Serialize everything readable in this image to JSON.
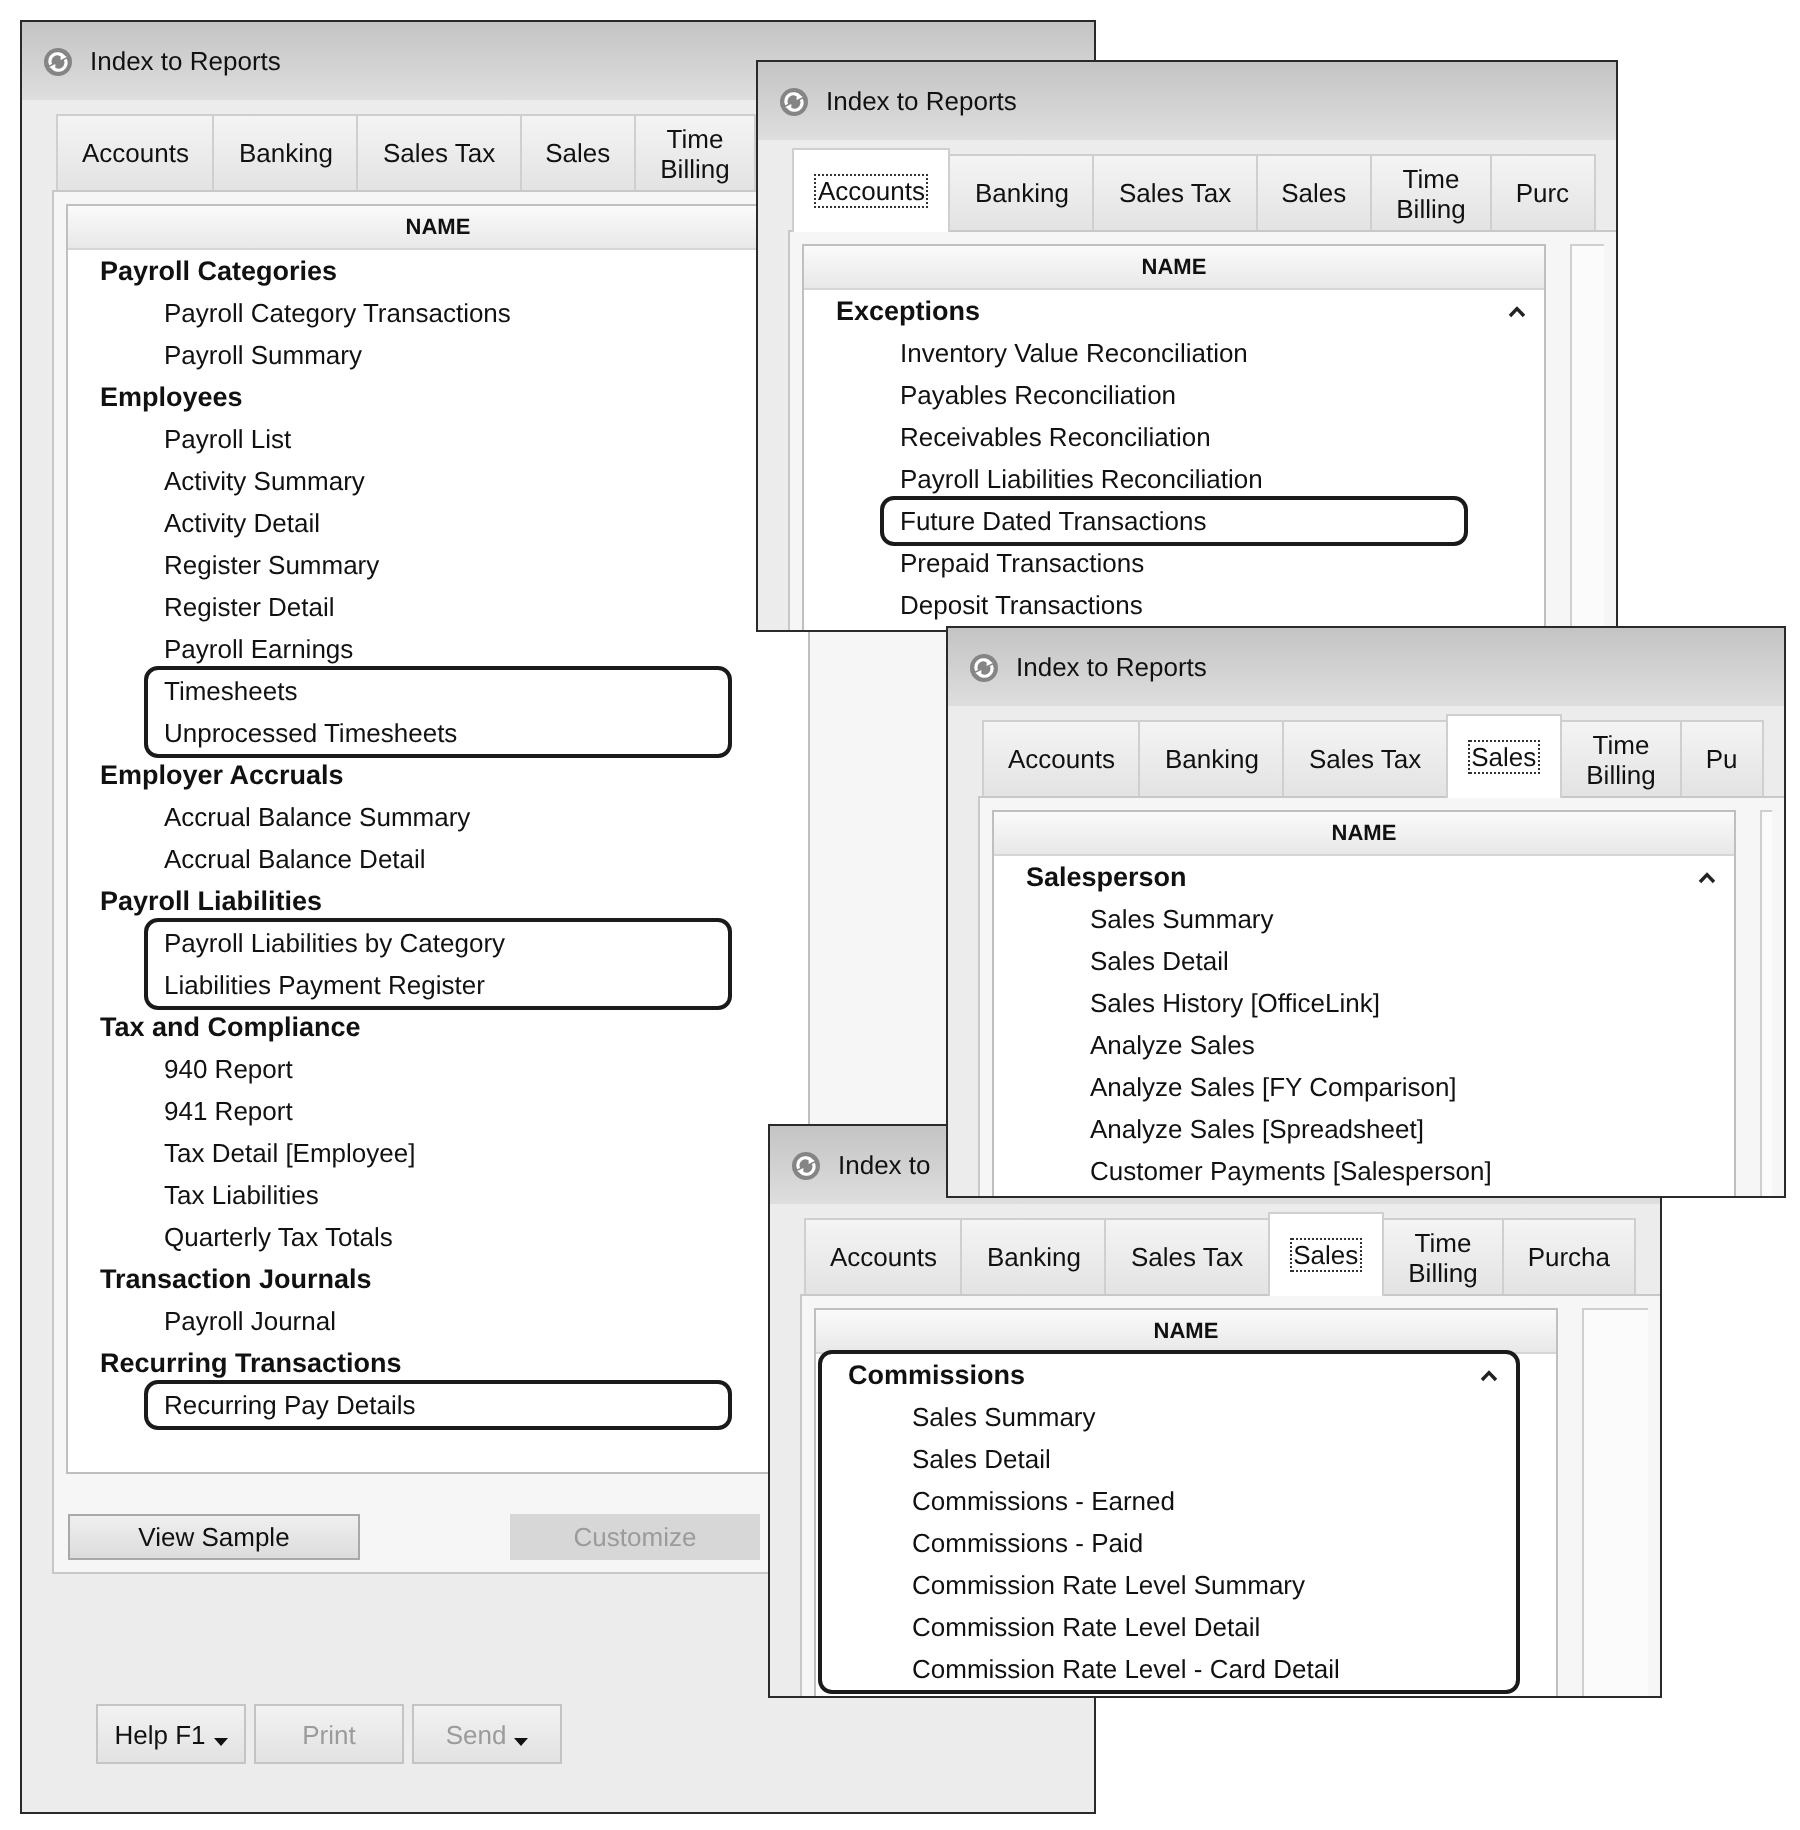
{
  "windows": [
    {
      "title": "Index to Reports",
      "tabs": [
        {
          "label": "Accounts",
          "selected": false
        },
        {
          "label": "Banking",
          "selected": false
        },
        {
          "label": "Sales Tax",
          "selected": false
        },
        {
          "label": "Sales",
          "selected": false
        },
        {
          "label": "Time\nBilling",
          "selected": false
        }
      ],
      "list": {
        "header": "NAME",
        "rows": [
          {
            "kind": "group",
            "text": "Payroll Categories"
          },
          {
            "kind": "item",
            "text": "Payroll Category Transactions"
          },
          {
            "kind": "item",
            "text": "Payroll Summary"
          },
          {
            "kind": "group",
            "text": "Employees"
          },
          {
            "kind": "item",
            "text": "Payroll List"
          },
          {
            "kind": "item",
            "text": "Activity Summary"
          },
          {
            "kind": "item",
            "text": "Activity Detail"
          },
          {
            "kind": "item",
            "text": "Register Summary"
          },
          {
            "kind": "item",
            "text": "Register Detail"
          },
          {
            "kind": "item",
            "text": "Payroll Earnings"
          },
          {
            "kind": "callout",
            "rows": [
              {
                "kind": "item",
                "text": "Timesheets"
              },
              {
                "kind": "item",
                "text": "Unprocessed Timesheets"
              }
            ]
          },
          {
            "kind": "group",
            "text": "Employer Accruals"
          },
          {
            "kind": "item",
            "text": "Accrual Balance Summary"
          },
          {
            "kind": "item",
            "text": "Accrual Balance Detail"
          },
          {
            "kind": "group",
            "text": "Payroll Liabilities"
          },
          {
            "kind": "callout",
            "rows": [
              {
                "kind": "item",
                "text": "Payroll Liabilities by Category"
              },
              {
                "kind": "item",
                "text": "Liabilities Payment Register"
              }
            ]
          },
          {
            "kind": "group",
            "text": "Tax and Compliance"
          },
          {
            "kind": "item",
            "text": "940 Report"
          },
          {
            "kind": "item",
            "text": "941 Report"
          },
          {
            "kind": "item",
            "text": "Tax Detail [Employee]"
          },
          {
            "kind": "item",
            "text": "Tax Liabilities"
          },
          {
            "kind": "item",
            "text": "Quarterly Tax Totals"
          },
          {
            "kind": "group",
            "text": "Transaction Journals"
          },
          {
            "kind": "item",
            "text": "Payroll Journal"
          },
          {
            "kind": "group",
            "text": "Recurring Transactions"
          },
          {
            "kind": "callout",
            "rows": [
              {
                "kind": "item",
                "text": "Recurring Pay Details"
              }
            ]
          }
        ]
      },
      "actions": [
        {
          "label": "View Sample",
          "disabled": false
        },
        {
          "label": "Customize",
          "disabled": true
        }
      ],
      "footer_buttons": [
        {
          "label": "Help F1",
          "disabled": false,
          "dropdown": true
        },
        {
          "label": "Print",
          "disabled": true,
          "dropdown": false
        },
        {
          "label": "Send",
          "disabled": true,
          "dropdown": true
        }
      ]
    },
    {
      "title": "Index to Reports",
      "tabs": [
        {
          "label": "Accounts",
          "selected": true
        },
        {
          "label": "Banking",
          "selected": false
        },
        {
          "label": "Sales Tax",
          "selected": false
        },
        {
          "label": "Sales",
          "selected": false
        },
        {
          "label": "Time\nBilling",
          "selected": false
        },
        {
          "label": "Purc",
          "selected": false
        }
      ],
      "list": {
        "header": "NAME",
        "rows": [
          {
            "kind": "group",
            "text": "Exceptions",
            "expanded": true
          },
          {
            "kind": "item",
            "text": "Inventory Value Reconciliation"
          },
          {
            "kind": "item",
            "text": "Payables Reconciliation"
          },
          {
            "kind": "item",
            "text": "Receivables Reconciliation"
          },
          {
            "kind": "item",
            "text": "Payroll Liabilities Reconciliation"
          },
          {
            "kind": "callout",
            "rows": [
              {
                "kind": "item",
                "text": "Future Dated Transactions"
              }
            ]
          },
          {
            "kind": "item",
            "text": "Prepaid Transactions"
          },
          {
            "kind": "item",
            "text": "Deposit Transactions"
          }
        ]
      }
    },
    {
      "title": "Index to Reports",
      "tabs": [
        {
          "label": "Accounts",
          "selected": false
        },
        {
          "label": "Banking",
          "selected": false
        },
        {
          "label": "Sales Tax",
          "selected": false
        },
        {
          "label": "Sales",
          "selected": true
        },
        {
          "label": "Time\nBilling",
          "selected": false
        },
        {
          "label": "Pu",
          "selected": false
        }
      ],
      "list": {
        "header": "NAME",
        "rows": [
          {
            "kind": "group",
            "text": "Salesperson",
            "expanded": true
          },
          {
            "kind": "item",
            "text": "Sales Summary"
          },
          {
            "kind": "item",
            "text": "Sales Detail"
          },
          {
            "kind": "item",
            "text": "Sales History [OfficeLink]"
          },
          {
            "kind": "item",
            "text": "Analyze Sales"
          },
          {
            "kind": "item",
            "text": "Analyze Sales [FY Comparison]"
          },
          {
            "kind": "item",
            "text": "Analyze Sales [Spreadsheet]"
          },
          {
            "kind": "item",
            "text": "Customer Payments [Salesperson]"
          }
        ]
      }
    },
    {
      "title": "Index to",
      "tabs": [
        {
          "label": "Accounts",
          "selected": false
        },
        {
          "label": "Banking",
          "selected": false
        },
        {
          "label": "Sales Tax",
          "selected": false
        },
        {
          "label": "Sales",
          "selected": true
        },
        {
          "label": "Time\nBilling",
          "selected": false
        },
        {
          "label": "Purcha",
          "selected": false
        }
      ],
      "list": {
        "header": "NAME",
        "rows": [
          {
            "kind": "callout",
            "rows": [
              {
                "kind": "group",
                "text": "Commissions",
                "expanded": true
              },
              {
                "kind": "item",
                "text": "Sales Summary"
              },
              {
                "kind": "item",
                "text": "Sales Detail"
              },
              {
                "kind": "item",
                "text": "Commissions - Earned"
              },
              {
                "kind": "item",
                "text": "Commissions - Paid"
              },
              {
                "kind": "item",
                "text": "Commission Rate Level Summary"
              },
              {
                "kind": "item",
                "text": "Commission Rate Level Detail"
              },
              {
                "kind": "item",
                "text": "Commission Rate Level - Card Detail"
              }
            ]
          }
        ]
      }
    }
  ]
}
